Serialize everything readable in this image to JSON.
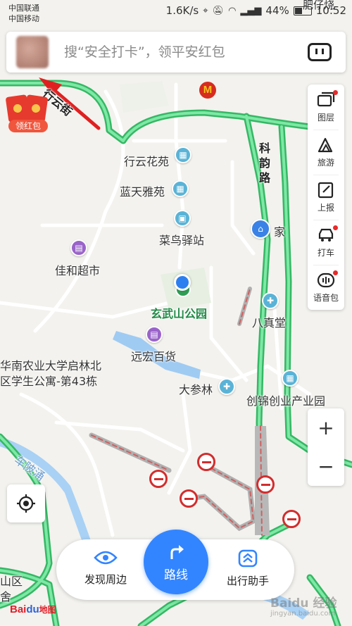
{
  "status_bar": {
    "carrier1": "中国联通",
    "carrier2": "中国移动",
    "speed": "1.6K/s",
    "battery": "44%",
    "time": "10:52"
  },
  "search": {
    "placeholder": "搜“安全打卡”，领平安红包"
  },
  "red_packet": {
    "label": "领红包"
  },
  "map": {
    "roads": {
      "xingyun_street": "行云街",
      "keyun_road": "科韵路"
    },
    "pois": {
      "xingyun_garden": "行云花苑",
      "lantian_garden": "蓝天雅苑",
      "cainiao": "菜鸟驿站",
      "home": "家",
      "jiahe": "佳和超市",
      "xuanwushan_park": "玄武山公园",
      "bazhentang": "八真堂",
      "yuanhong": "远宏百货",
      "university_line1": "华南农业大学启林北",
      "university_line2": "区学生公寓-第43栋",
      "dashenlin": "大参林",
      "chuangjin": "创锦创业产业园",
      "feizai": "肥仔烧",
      "chelingyong": "车陂涌",
      "shanqu": "山区",
      "she": "舍"
    }
  },
  "tools": [
    {
      "label": "图层",
      "icon": "layers-icon",
      "badge": true
    },
    {
      "label": "旅游",
      "icon": "travel-icon",
      "badge": false
    },
    {
      "label": "上报",
      "icon": "report-icon",
      "badge": false
    },
    {
      "label": "打车",
      "icon": "taxi-icon",
      "badge": true
    },
    {
      "label": "语音包",
      "icon": "voice-pack-icon",
      "badge": true
    }
  ],
  "zoom": {
    "in": "+",
    "out": "−"
  },
  "bottom_bar": {
    "nearby": "发现周边",
    "route": "路线",
    "assistant": "出行助手"
  },
  "logo": {
    "brand_a": "Bai",
    "brand_b": "du",
    "brand_c": "地图"
  },
  "watermark": {
    "text": "Baidu 经验",
    "url": "jingyan.baidu.com"
  },
  "colors": {
    "road_green": "#4fd17c",
    "accent_blue": "#3385ff",
    "arrow_red": "#e02020"
  }
}
